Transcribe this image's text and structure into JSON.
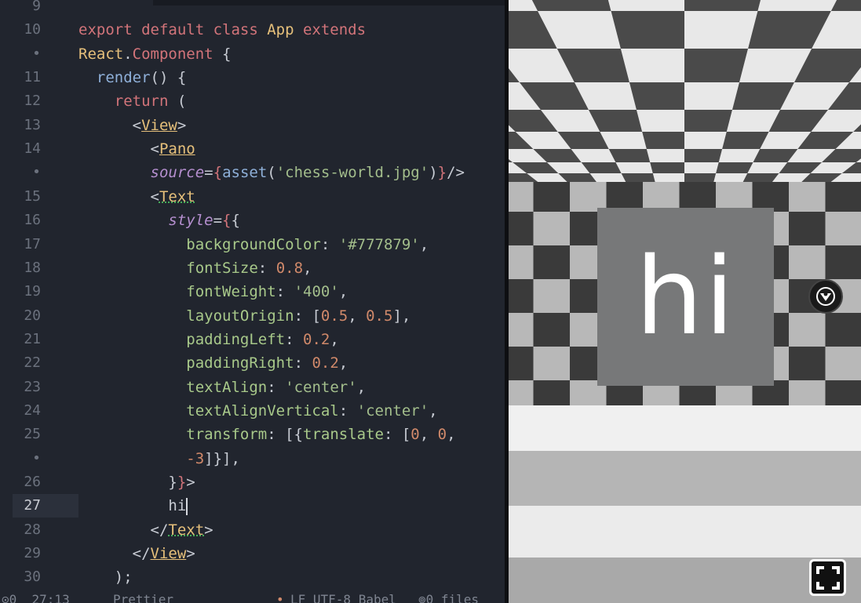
{
  "editor": {
    "lines": [
      {
        "num": "9",
        "active": false,
        "tokens": [
          {
            "t": "",
            "c": "plain"
          }
        ]
      },
      {
        "num": "10",
        "active": false,
        "tokens": [
          {
            "t": "export default class ",
            "c": "kw"
          },
          {
            "t": "App",
            "c": "cls"
          },
          {
            "t": " extends",
            "c": "kw"
          }
        ]
      },
      {
        "num": "•",
        "active": false,
        "tokens": [
          {
            "t": "React",
            "c": "cls"
          },
          {
            "t": ".",
            "c": "plain"
          },
          {
            "t": "Component",
            "c": "kw"
          },
          {
            "t": " {",
            "c": "plain"
          }
        ]
      },
      {
        "num": "11",
        "active": false,
        "tokens": [
          {
            "t": "  ",
            "c": "plain"
          },
          {
            "t": "render",
            "c": "fn"
          },
          {
            "t": "() {",
            "c": "plain"
          }
        ]
      },
      {
        "num": "12",
        "active": false,
        "tokens": [
          {
            "t": "    ",
            "c": "plain"
          },
          {
            "t": "return",
            "c": "kw"
          },
          {
            "t": " (",
            "c": "plain"
          }
        ]
      },
      {
        "num": "13",
        "active": false,
        "tokens": [
          {
            "t": "      <",
            "c": "plain"
          },
          {
            "t": "View",
            "c": "tag"
          },
          {
            "t": ">",
            "c": "plain"
          }
        ]
      },
      {
        "num": "14",
        "active": false,
        "tokens": [
          {
            "t": "        <",
            "c": "plain"
          },
          {
            "t": "Pano",
            "c": "tag"
          }
        ]
      },
      {
        "num": "•",
        "active": false,
        "tokens": [
          {
            "t": "        ",
            "c": "plain"
          },
          {
            "t": "source",
            "c": "attr"
          },
          {
            "t": "=",
            "c": "plain"
          },
          {
            "t": "{",
            "c": "jsx"
          },
          {
            "t": "asset",
            "c": "fn"
          },
          {
            "t": "(",
            "c": "plain"
          },
          {
            "t": "'chess-world.jpg'",
            "c": "str"
          },
          {
            "t": ")",
            "c": "plain"
          },
          {
            "t": "}",
            "c": "jsx"
          },
          {
            "t": "/>",
            "c": "plain"
          }
        ]
      },
      {
        "num": "15",
        "active": false,
        "tokens": [
          {
            "t": "        <",
            "c": "plain"
          },
          {
            "t": "Text",
            "c": "tag-ul"
          }
        ]
      },
      {
        "num": "16",
        "active": false,
        "tokens": [
          {
            "t": "          ",
            "c": "plain"
          },
          {
            "t": "style",
            "c": "attr"
          },
          {
            "t": "=",
            "c": "plain"
          },
          {
            "t": "{",
            "c": "jsx"
          },
          {
            "t": "{",
            "c": "plain"
          }
        ]
      },
      {
        "num": "17",
        "active": false,
        "tokens": [
          {
            "t": "            ",
            "c": "plain"
          },
          {
            "t": "backgroundColor",
            "c": "prop"
          },
          {
            "t": ": ",
            "c": "plain"
          },
          {
            "t": "'#777879'",
            "c": "str"
          },
          {
            "t": ",",
            "c": "plain"
          }
        ]
      },
      {
        "num": "18",
        "active": false,
        "tokens": [
          {
            "t": "            ",
            "c": "plain"
          },
          {
            "t": "fontSize",
            "c": "prop"
          },
          {
            "t": ": ",
            "c": "plain"
          },
          {
            "t": "0.8",
            "c": "num"
          },
          {
            "t": ",",
            "c": "plain"
          }
        ]
      },
      {
        "num": "19",
        "active": false,
        "tokens": [
          {
            "t": "            ",
            "c": "plain"
          },
          {
            "t": "fontWeight",
            "c": "prop"
          },
          {
            "t": ": ",
            "c": "plain"
          },
          {
            "t": "'400'",
            "c": "str"
          },
          {
            "t": ",",
            "c": "plain"
          }
        ]
      },
      {
        "num": "20",
        "active": false,
        "tokens": [
          {
            "t": "            ",
            "c": "plain"
          },
          {
            "t": "layoutOrigin",
            "c": "prop"
          },
          {
            "t": ": [",
            "c": "plain"
          },
          {
            "t": "0.5",
            "c": "num"
          },
          {
            "t": ", ",
            "c": "plain"
          },
          {
            "t": "0.5",
            "c": "num"
          },
          {
            "t": "],",
            "c": "plain"
          }
        ]
      },
      {
        "num": "21",
        "active": false,
        "tokens": [
          {
            "t": "            ",
            "c": "plain"
          },
          {
            "t": "paddingLeft",
            "c": "prop"
          },
          {
            "t": ": ",
            "c": "plain"
          },
          {
            "t": "0.2",
            "c": "num"
          },
          {
            "t": ",",
            "c": "plain"
          }
        ]
      },
      {
        "num": "22",
        "active": false,
        "tokens": [
          {
            "t": "            ",
            "c": "plain"
          },
          {
            "t": "paddingRight",
            "c": "prop"
          },
          {
            "t": ": ",
            "c": "plain"
          },
          {
            "t": "0.2",
            "c": "num"
          },
          {
            "t": ",",
            "c": "plain"
          }
        ]
      },
      {
        "num": "23",
        "active": false,
        "tokens": [
          {
            "t": "            ",
            "c": "plain"
          },
          {
            "t": "textAlign",
            "c": "prop"
          },
          {
            "t": ": ",
            "c": "plain"
          },
          {
            "t": "'center'",
            "c": "str"
          },
          {
            "t": ",",
            "c": "plain"
          }
        ]
      },
      {
        "num": "24",
        "active": false,
        "tokens": [
          {
            "t": "            ",
            "c": "plain"
          },
          {
            "t": "textAlignVertical",
            "c": "prop"
          },
          {
            "t": ": ",
            "c": "plain"
          },
          {
            "t": "'center'",
            "c": "str"
          },
          {
            "t": ",",
            "c": "plain"
          }
        ]
      },
      {
        "num": "25",
        "active": false,
        "tokens": [
          {
            "t": "            ",
            "c": "plain"
          },
          {
            "t": "transform",
            "c": "prop"
          },
          {
            "t": ": [{",
            "c": "plain"
          },
          {
            "t": "translate",
            "c": "prop"
          },
          {
            "t": ": [",
            "c": "plain"
          },
          {
            "t": "0",
            "c": "num"
          },
          {
            "t": ", ",
            "c": "plain"
          },
          {
            "t": "0",
            "c": "num"
          },
          {
            "t": ",",
            "c": "plain"
          }
        ]
      },
      {
        "num": "•",
        "active": false,
        "tokens": [
          {
            "t": "            ",
            "c": "plain"
          },
          {
            "t": "-3",
            "c": "num"
          },
          {
            "t": "]}],",
            "c": "plain"
          }
        ]
      },
      {
        "num": "26",
        "active": false,
        "tokens": [
          {
            "t": "          ",
            "c": "plain"
          },
          {
            "t": "}",
            "c": "plain"
          },
          {
            "t": "}",
            "c": "jsx"
          },
          {
            "t": ">",
            "c": "plain"
          }
        ]
      },
      {
        "num": "27",
        "active": true,
        "tokens": [
          {
            "t": "          hi",
            "c": "plain"
          }
        ]
      },
      {
        "num": "28",
        "active": false,
        "tokens": [
          {
            "t": "        </",
            "c": "plain"
          },
          {
            "t": "Text",
            "c": "tag-ul"
          },
          {
            "t": ">",
            "c": "plain"
          }
        ]
      },
      {
        "num": "29",
        "active": false,
        "tokens": [
          {
            "t": "      </",
            "c": "plain"
          },
          {
            "t": "View",
            "c": "tag"
          },
          {
            "t": ">",
            "c": "plain"
          }
        ]
      },
      {
        "num": "30",
        "active": false,
        "tokens": [
          {
            "t": "    );",
            "c": "plain"
          }
        ]
      }
    ]
  },
  "statusbar": {
    "position": "⊙0  27:13",
    "formatter": "Prettier",
    "dot": "•",
    "encoding": "LF UTF-8 Babel",
    "files": "⊚0 files"
  },
  "preview": {
    "hi_text": "hi",
    "hi_panel_color": "#777879"
  },
  "colors": {
    "editor_bg": "#21252e",
    "keyword": "#d2747a",
    "string": "#a3be8c",
    "number": "#d0896a",
    "class": "#e6c07b"
  }
}
